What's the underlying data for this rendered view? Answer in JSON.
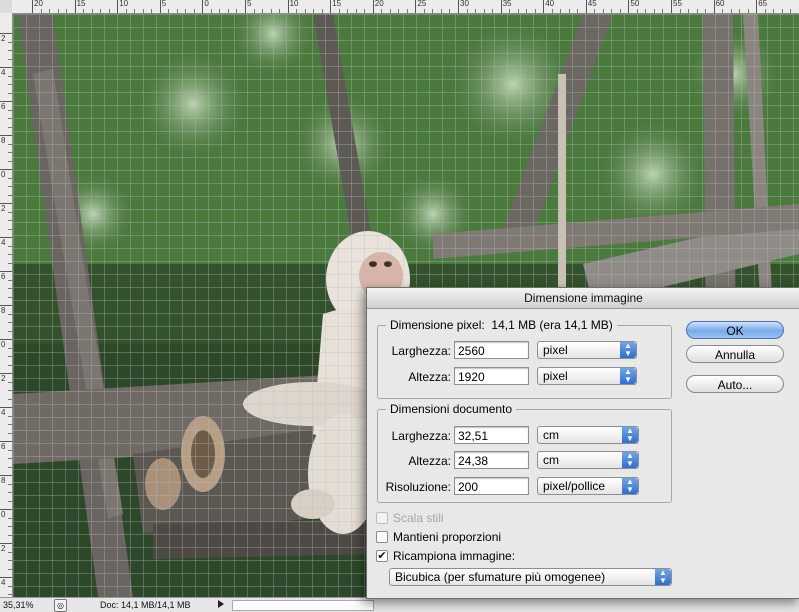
{
  "ruler_top": {
    "labels": [
      "20",
      "15",
      "10",
      "5",
      "0",
      "5",
      "10",
      "15",
      "20",
      "25",
      "30",
      "35",
      "40",
      "45",
      "50",
      "55",
      "60",
      "65"
    ]
  },
  "ruler_left": {
    "labels": [
      "2",
      "4",
      "6",
      "8",
      "0",
      "2",
      "4",
      "6",
      "8",
      "0",
      "2",
      "4",
      "6",
      "8",
      "0",
      "2",
      "4"
    ]
  },
  "status": {
    "zoom": "35,31%",
    "doc": "Doc: 14,1 MB/14,1 MB"
  },
  "dialog": {
    "title": "Dimensione immagine",
    "pixel_dimensions": {
      "legend": "Dimensione pixel:",
      "size_info": "14,1 MB (era 14,1 MB)",
      "width_label": "Larghezza:",
      "width_value": "2560",
      "width_unit": "pixel",
      "height_label": "Altezza:",
      "height_value": "1920",
      "height_unit": "pixel"
    },
    "document_size": {
      "legend": "Dimensioni documento",
      "width_label": "Larghezza:",
      "width_value": "32,51",
      "width_unit": "cm",
      "height_label": "Altezza:",
      "height_value": "24,38",
      "height_unit": "cm",
      "resolution_label": "Risoluzione:",
      "resolution_value": "200",
      "resolution_unit": "pixel/pollice"
    },
    "options": {
      "scale_styles": "Scala stili",
      "constrain_proportions": "Mantieni proporzioni",
      "resample": "Ricampiona immagine:",
      "resample_method": "Bicubica (per sfumature più omogenee)"
    },
    "buttons": {
      "ok": "OK",
      "cancel": "Annulla",
      "auto": "Auto..."
    }
  }
}
